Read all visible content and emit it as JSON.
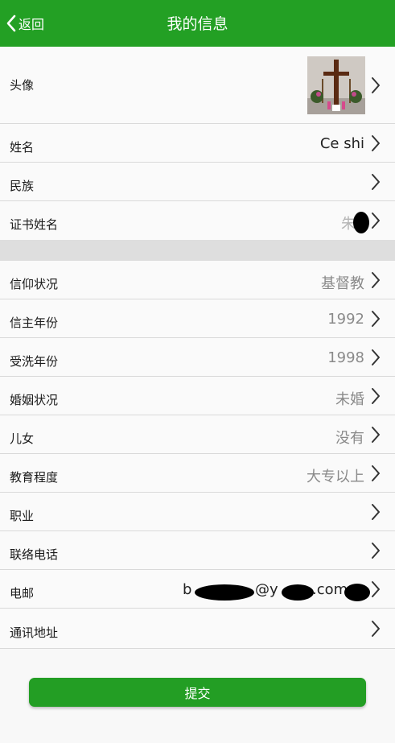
{
  "header": {
    "back_label": "返回",
    "title": "我的信息",
    "color": "#23a024"
  },
  "rows": {
    "avatar": {
      "label": "头像"
    },
    "name": {
      "label": "姓名",
      "value": "Ce shi"
    },
    "ethnicity": {
      "label": "民族",
      "value": ""
    },
    "cert_name": {
      "label": "证书姓名",
      "value": "朱"
    },
    "faith": {
      "label": "信仰状况",
      "value": "基督教"
    },
    "believe_year": {
      "label": "信主年份",
      "value": "1992"
    },
    "baptism_year": {
      "label": "受洗年份",
      "value": "1998"
    },
    "marital": {
      "label": "婚姻状况",
      "value": "未婚"
    },
    "children": {
      "label": "儿女",
      "value": "没有"
    },
    "education": {
      "label": "教育程度",
      "value": "大专以上"
    },
    "occupation": {
      "label": "职业",
      "value": ""
    },
    "phone": {
      "label": "联络电话",
      "value": ""
    },
    "email": {
      "label": "电邮",
      "value_parts": [
        "b",
        "@y",
        ".com"
      ]
    },
    "address": {
      "label": "通讯地址",
      "value": ""
    }
  },
  "submit": {
    "label": "提交"
  },
  "icons": {
    "back": "chevron-left-icon",
    "row": "chevron-right-icon"
  }
}
